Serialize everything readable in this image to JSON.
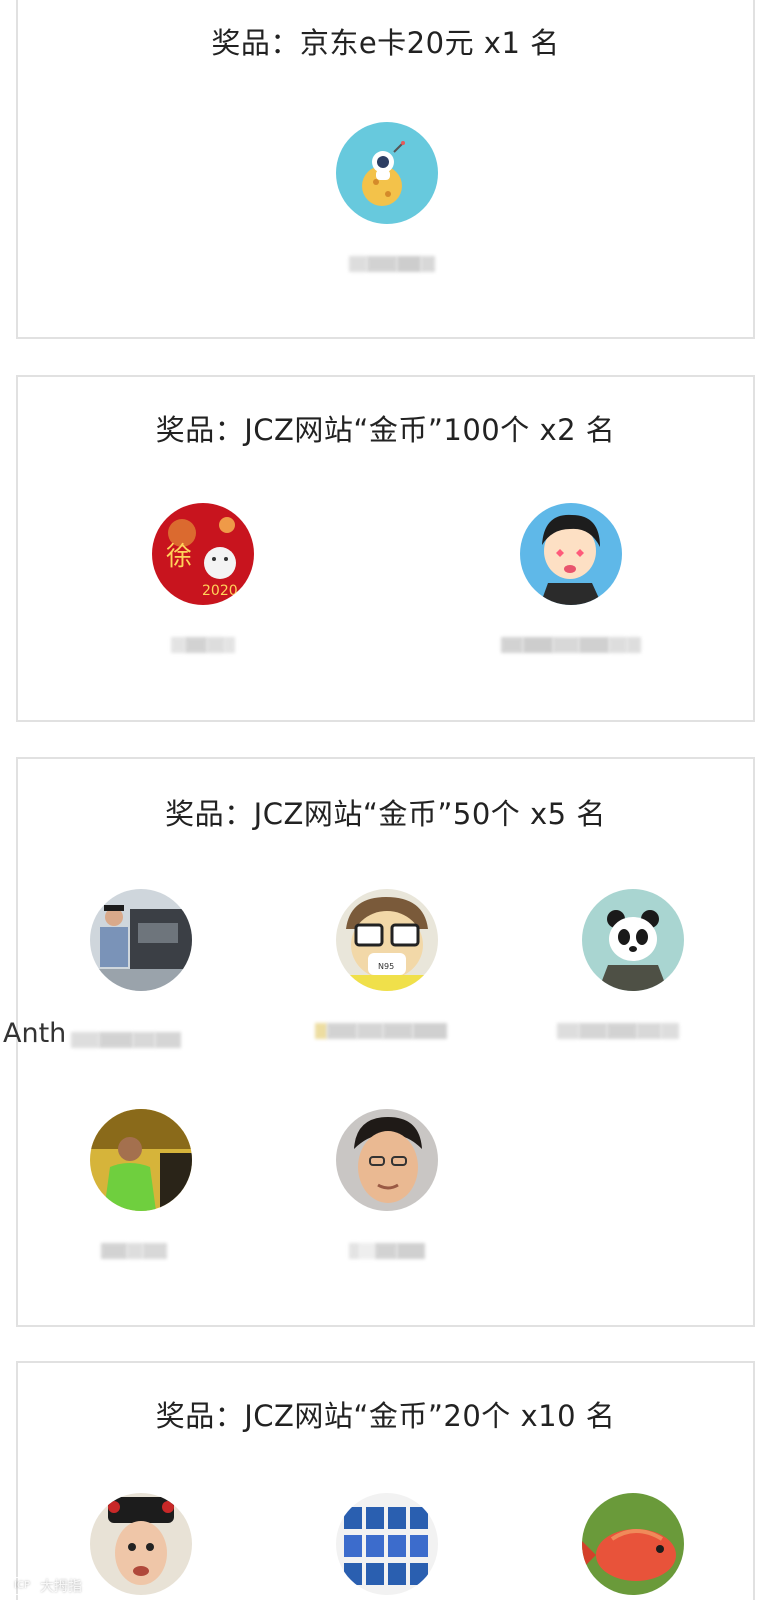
{
  "cards": [
    {
      "title": "奖品：京东e卡20元 x1 名",
      "winners": [
        {
          "name": "",
          "avatar": "astronaut-avatar"
        }
      ]
    },
    {
      "title": "奖品：JCZ网站“金币”100个 x2 名",
      "winners": [
        {
          "name": "",
          "avatar": "new-year-rat-avatar"
        },
        {
          "name": "",
          "avatar": "cartoon-boy-avatar"
        }
      ]
    },
    {
      "title": "奖品：JCZ网站“金币”50个 x5 名",
      "winners": [
        {
          "name": "Anth",
          "avatar": "man-with-engine-avatar"
        },
        {
          "name": "",
          "avatar": "cartoon-glasses-avatar"
        },
        {
          "name": "",
          "avatar": "panda-avatar"
        },
        {
          "name": "",
          "avatar": "man-green-shirt-avatar"
        },
        {
          "name": "",
          "avatar": "man-face-avatar"
        }
      ]
    },
    {
      "title": "奖品：JCZ网站“金币”20个 x10 名",
      "winners": [
        {
          "name": "",
          "avatar": "costume-face-avatar"
        },
        {
          "name": "",
          "avatar": "jerseys-avatar"
        },
        {
          "name": "",
          "avatar": "red-fish-avatar"
        }
      ]
    }
  ],
  "watermark": {
    "logo": "ICP",
    "text": "大拇指"
  }
}
